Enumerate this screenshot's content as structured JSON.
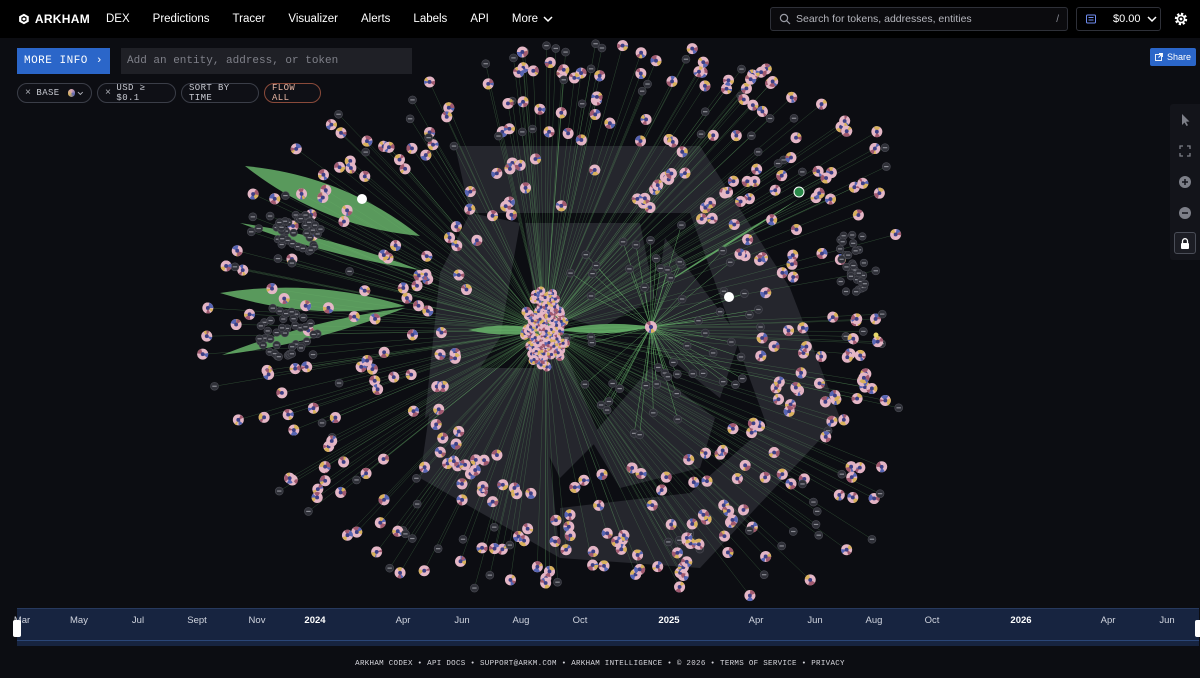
{
  "brand": {
    "name": "ARKHAM"
  },
  "nav": {
    "items": [
      "DEX",
      "Predictions",
      "Tracer",
      "Visualizer",
      "Alerts",
      "Labels",
      "API"
    ],
    "more_label": "More"
  },
  "search": {
    "placeholder": "Search for tokens, addresses, entities",
    "shortcut": "/"
  },
  "wallet": {
    "balance": "$0.00"
  },
  "toolbar": {
    "more_info_label": "MORE INFO",
    "entity_placeholder": "Add an entity, address, or token",
    "share_label": "Share"
  },
  "filters": {
    "chain": "BASE",
    "usd": "USD ≥ $0.1",
    "sort": "SORT BY TIME",
    "flow": "FLOW ALL"
  },
  "timeline": {
    "months": [
      "Mar",
      "May",
      "Jul",
      "Sept",
      "Nov",
      "2024",
      "Apr",
      "Jun",
      "Aug",
      "Oct",
      "2025",
      "Apr",
      "Jun",
      "Aug",
      "Oct",
      "2026",
      "Apr",
      "Jun"
    ],
    "years": [
      "2024",
      "2025",
      "2026"
    ]
  },
  "footer": {
    "links": [
      "ARKHAM CODEX",
      "API DOCS",
      "SUPPORT@ARKM.COM",
      "ARKHAM INTELLIGENCE",
      "© 2026",
      "TERMS OF SERVICE",
      "PRIVACY"
    ]
  },
  "colors": {
    "accent": "#2b66c9",
    "flow_edge": "#67b36a",
    "background": "#0c0d12"
  },
  "icons": {
    "search": "search-icon",
    "settings": "gear-icon",
    "wallet": "wallet-icon",
    "share": "share-icon",
    "select": "pointer-icon",
    "fit": "fit-screen-icon",
    "zoom_in": "zoom-in-icon",
    "zoom_out": "zoom-out-icon",
    "lock": "lock-icon"
  }
}
